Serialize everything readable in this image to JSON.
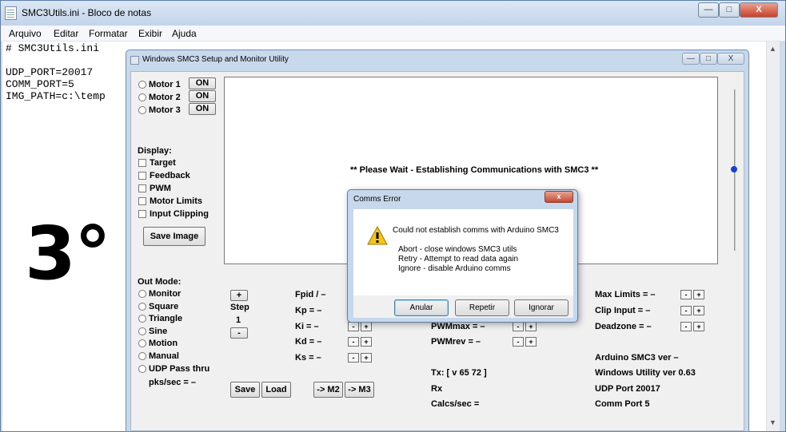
{
  "notepad": {
    "title": "SMC3Utils.ini - Bloco de notas",
    "window_controls": {
      "minimize": "—",
      "maximize": "□",
      "close": "X"
    },
    "menu": [
      "Arquivo",
      "Editar",
      "Formatar",
      "Exibir",
      "Ajuda"
    ],
    "lines": [
      "# SMC3Utils.ini",
      "",
      "UDP_PORT=20017",
      "COMM_PORT=5",
      "IMG_PATH=c:\\temp"
    ],
    "overlay_text": "3°"
  },
  "smc": {
    "title": "Windows SMC3 Setup and Monitor Utility",
    "motors": [
      {
        "label": "Motor 1",
        "button": "ON"
      },
      {
        "label": "Motor 2",
        "button": "ON"
      },
      {
        "label": "Motor 3",
        "button": "ON"
      }
    ],
    "display_label": "Display:",
    "display_options": [
      "Target",
      "Feedback",
      "PWM",
      "Motor Limits",
      "Input Clipping"
    ],
    "save_image": "Save Image",
    "plot_message": "** Please Wait - Establishing Communications with SMC3 **",
    "out_mode_label": "Out Mode:",
    "out_modes": [
      "Monitor",
      "Square",
      "Triangle",
      "Sine",
      "Motion",
      "Manual",
      "UDP Pass thru"
    ],
    "pks_sec": "pks/sec = –",
    "step": {
      "plus": "+",
      "label": "Step",
      "value": "1",
      "minus": "-"
    },
    "pid": [
      {
        "label": "Fpid / –"
      },
      {
        "label": "Kp = –"
      },
      {
        "label": "Ki = –"
      },
      {
        "label": "Kd = –"
      },
      {
        "label": "Ks = –"
      }
    ],
    "pwm": [
      {
        "label": "PWMmax = –"
      },
      {
        "label": "PWMrev = –"
      }
    ],
    "limits": [
      {
        "label": "Max Limits = –"
      },
      {
        "label": "Clip Input = –"
      },
      {
        "label": "Deadzone = –"
      }
    ],
    "bottom_buttons": {
      "save": "Save",
      "load": "Load",
      "to_m2": "-> M2",
      "to_m3": "-> M3"
    },
    "tx": "Tx: [ v 65 72 ]",
    "rx": "Rx",
    "calcs": "Calcs/sec =",
    "info": [
      "Arduino SMC3 ver –",
      "Windows Utility ver 0.63",
      "UDP Port 20017",
      "Comm Port 5"
    ],
    "pm_plus": "+",
    "pm_minus": "-"
  },
  "dialog": {
    "title": "Comms Error",
    "close": "x",
    "message": "Could not establish comms with Arduino SMC3",
    "options": [
      "Abort - close windows SMC3 utils",
      "Retry - Attempt to read data again",
      "Ignore - disable Arduino comms"
    ],
    "buttons": {
      "abort": "Anular",
      "retry": "Repetir",
      "ignore": "Ignorar"
    }
  }
}
